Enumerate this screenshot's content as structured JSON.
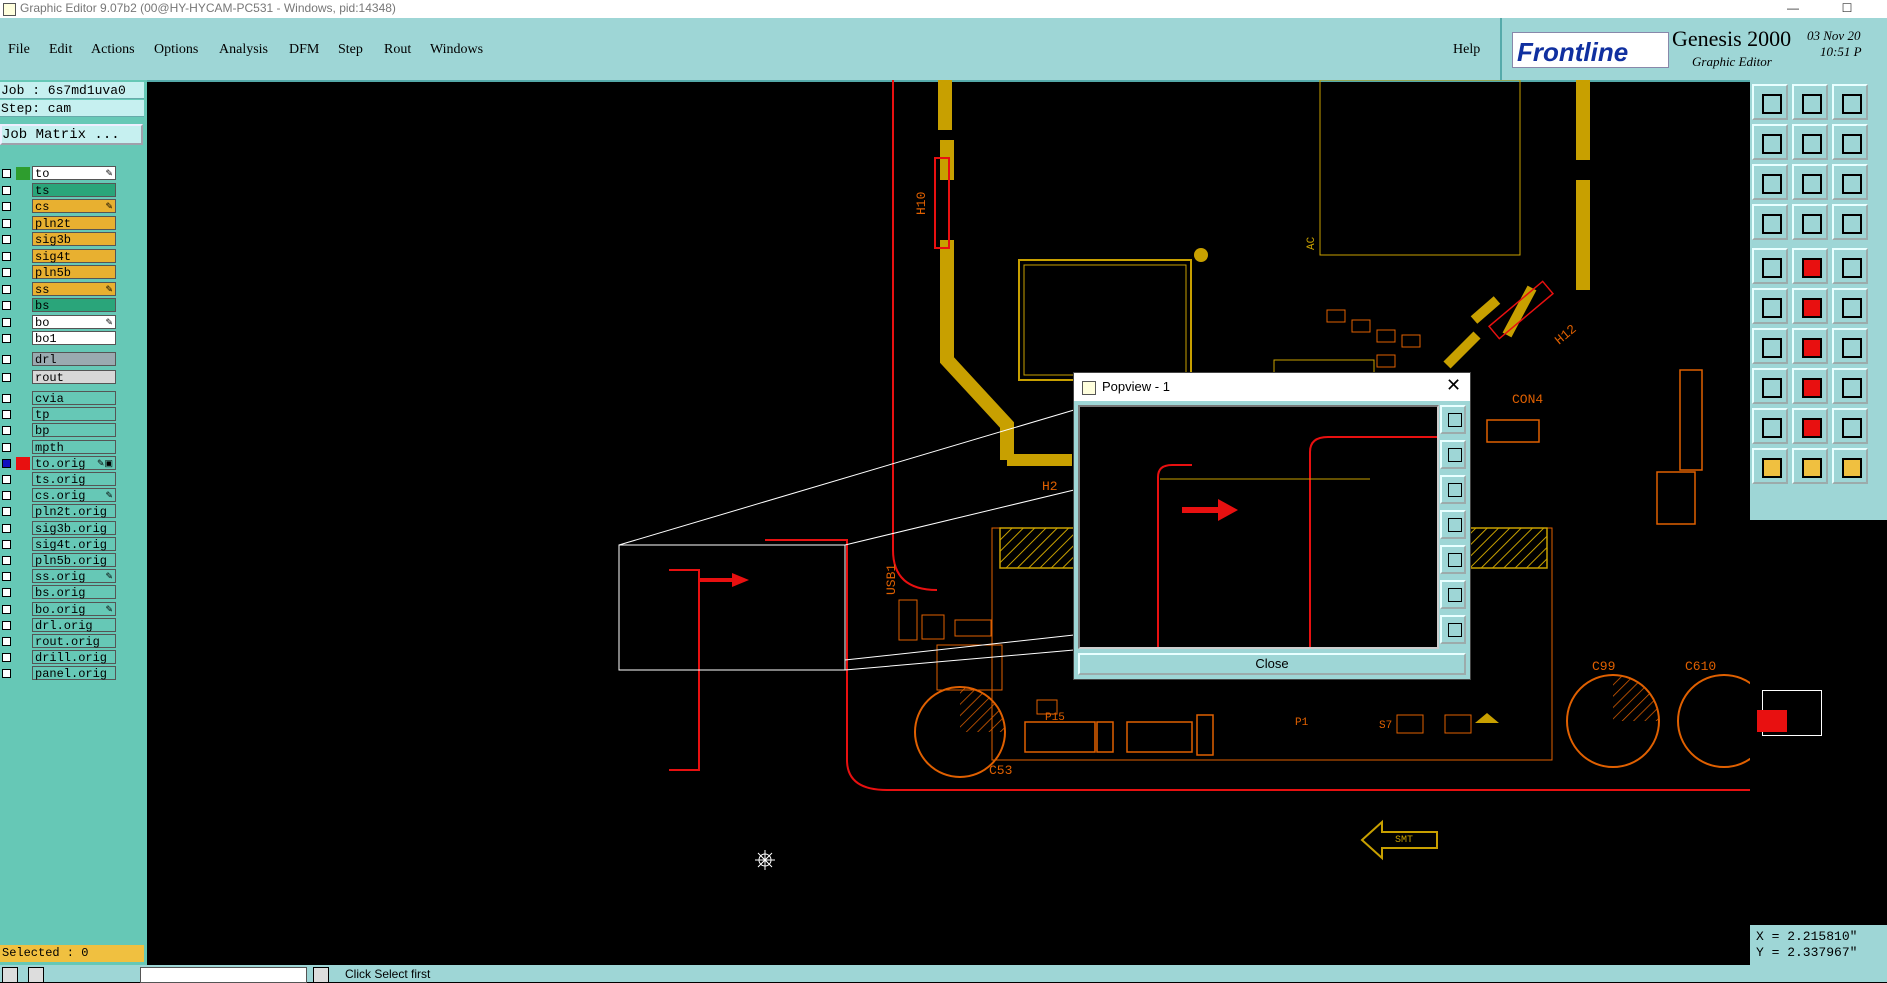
{
  "window": {
    "title": "Graphic Editor 9.07b2 (00@HY-HYCAM-PC531 - Windows, pid:14348)"
  },
  "menu": {
    "file": "File",
    "edit": "Edit",
    "actions": "Actions",
    "options": "Options",
    "analysis": "Analysis",
    "dfm": "DFM",
    "step": "Step",
    "rout": "Rout",
    "windows": "Windows",
    "help": "Help"
  },
  "brand": {
    "logo": "Frontline",
    "product": "Genesis 2000",
    "sub": "Graphic Editor",
    "date": "03 Nov 20",
    "time": "10:51 P"
  },
  "job": {
    "job_label": "Job : 6s7md1uva0",
    "step_label": "Step: cam",
    "matrix_button": "Job Matrix ..."
  },
  "layers": [
    {
      "name": "to",
      "bg": "#ffffff",
      "color": "#2e9d2e",
      "mark": "✎"
    },
    {
      "name": "ts",
      "bg": "#2aa57a",
      "color": "",
      "mark": ""
    },
    {
      "name": "cs",
      "bg": "#e8b030",
      "color": "",
      "mark": "✎"
    },
    {
      "name": "pln2t",
      "bg": "#e8b030",
      "color": "",
      "mark": ""
    },
    {
      "name": "sig3b",
      "bg": "#e8b030",
      "color": "",
      "mark": ""
    },
    {
      "name": "sig4t",
      "bg": "#e8b030",
      "color": "",
      "mark": ""
    },
    {
      "name": "pln5b",
      "bg": "#e8b030",
      "color": "",
      "mark": ""
    },
    {
      "name": "ss",
      "bg": "#e8b030",
      "color": "",
      "mark": "✎"
    },
    {
      "name": "bs",
      "bg": "#2aa57a",
      "color": "",
      "mark": ""
    },
    {
      "name": "bo",
      "bg": "#ffffff",
      "color": "",
      "mark": "✎"
    },
    {
      "name": "bo1",
      "bg": "#ffffff",
      "color": "",
      "mark": ""
    }
  ],
  "layers2": [
    {
      "name": "drl",
      "bg": "#9aaab0"
    },
    {
      "name": "rout",
      "bg": "#d8d8d8"
    }
  ],
  "layers3": [
    {
      "name": "cvia",
      "bg": "#66c8b6",
      "mark": ""
    },
    {
      "name": "tp",
      "bg": "#66c8b6",
      "mark": ""
    },
    {
      "name": "bp",
      "bg": "#66c8b6",
      "mark": ""
    },
    {
      "name": "mpth",
      "bg": "#66c8b6",
      "mark": ""
    },
    {
      "name": "to.orig",
      "bg": "#66c8b6",
      "mark": "✎▣",
      "color": "#e81010",
      "chk": "#1010c0"
    },
    {
      "name": "ts.orig",
      "bg": "#66c8b6",
      "mark": ""
    },
    {
      "name": "cs.orig",
      "bg": "#66c8b6",
      "mark": "✎"
    },
    {
      "name": "pln2t.orig",
      "bg": "#66c8b6",
      "mark": ""
    },
    {
      "name": "sig3b.orig",
      "bg": "#66c8b6",
      "mark": ""
    },
    {
      "name": "sig4t.orig",
      "bg": "#66c8b6",
      "mark": ""
    },
    {
      "name": "pln5b.orig",
      "bg": "#66c8b6",
      "mark": ""
    },
    {
      "name": "ss.orig",
      "bg": "#66c8b6",
      "mark": "✎"
    },
    {
      "name": "bs.orig",
      "bg": "#66c8b6",
      "mark": ""
    },
    {
      "name": "bo.orig",
      "bg": "#66c8b6",
      "mark": "✎"
    },
    {
      "name": "drl.orig",
      "bg": "#66c8b6",
      "mark": ""
    },
    {
      "name": "rout.orig",
      "bg": "#66c8b6",
      "mark": ""
    },
    {
      "name": "drill.orig",
      "bg": "#66c8b6",
      "mark": ""
    },
    {
      "name": "panel.orig",
      "bg": "#66c8b6",
      "mark": ""
    }
  ],
  "selected": "Selected : 0",
  "board_labels": {
    "h10": "H10",
    "h12": "H12",
    "h2": "H2",
    "con4": "CON4",
    "usb1": "USB1",
    "c53": "C53",
    "c99": "C99",
    "c610": "C610",
    "p15": "P15",
    "p1": "P1",
    "s7": "S7",
    "smt": "SMT",
    "ac": "AC"
  },
  "popview": {
    "title": "Popview - 1",
    "close": "Close"
  },
  "coords": {
    "x": "X = 2.215810\"",
    "y": "Y = 2.337967\""
  },
  "status": {
    "hint": "Click Select first"
  },
  "colors": {
    "pad": "#e81010",
    "trace": "#c8a000",
    "silk": "#e06000",
    "panel": "#9ed6d6"
  }
}
